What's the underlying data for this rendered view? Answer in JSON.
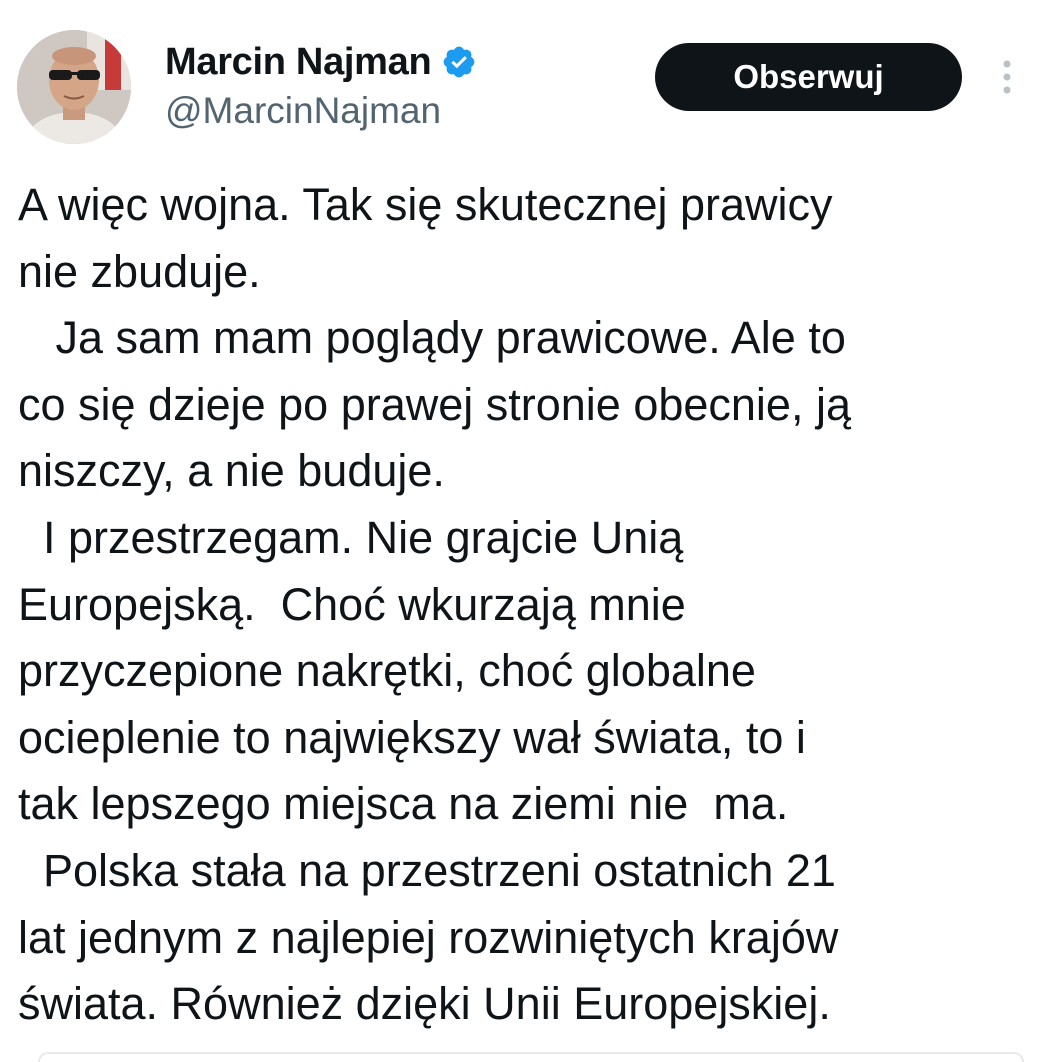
{
  "author": {
    "display_name": "Marcin Najman",
    "handle": "@MarcinNajman",
    "avatar_icon": "avatar-photo",
    "verified_icon": "verified-badge-icon",
    "verified_color": "#1d9bf0"
  },
  "actions": {
    "follow_label": "Obserwuj",
    "more_icon": "more-options-icon"
  },
  "tweet": {
    "lines": [
      "A więc wojna. Tak się skutecznej prawicy",
      "nie zbuduje.",
      "   Ja sam mam poglądy prawicowe. Ale to",
      "co się dzieje po prawej stronie obecnie, ją",
      "niszczy, a nie buduje.",
      "  I przestrzegam. Nie grajcie Unią",
      "Europejską.  Choć wkurzają mnie",
      "przyczepione nakrętki, choć globalne",
      "ocieplenie to największy wał świata, to i",
      "tak lepszego miejsca na ziemi nie  ma.",
      "  Polska stała na przestrzeni ostatnich 21",
      "lat jednym z najlepiej rozwiniętych krajów",
      "świata. Również dzięki Unii Europejskiej."
    ]
  }
}
